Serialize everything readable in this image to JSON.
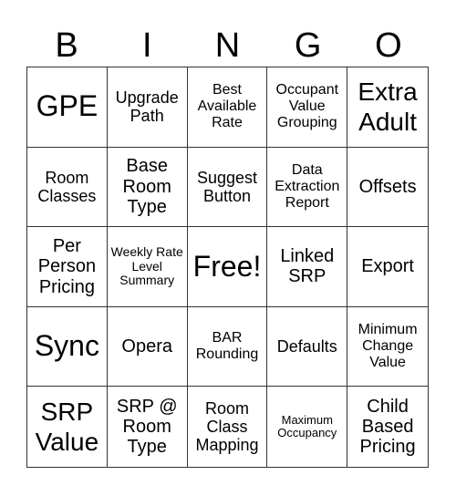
{
  "header": [
    "B",
    "I",
    "N",
    "G",
    "O"
  ],
  "cells": [
    {
      "text": "GPE",
      "size": "s-xl"
    },
    {
      "text": "Upgrade Path",
      "size": "s-n"
    },
    {
      "text": "Best Available Rate",
      "size": "s-s"
    },
    {
      "text": "Occupant Value Grouping",
      "size": "s-s"
    },
    {
      "text": "Extra Adult",
      "size": "s-l"
    },
    {
      "text": "Room Classes",
      "size": "s-n"
    },
    {
      "text": "Base Room Type",
      "size": "s-m"
    },
    {
      "text": "Suggest Button",
      "size": "s-n"
    },
    {
      "text": "Data Extraction Report",
      "size": "s-s"
    },
    {
      "text": "Offsets",
      "size": "s-m"
    },
    {
      "text": "Per Person Pricing",
      "size": "s-m"
    },
    {
      "text": "Weekly Rate Level Summary",
      "size": "s-xs"
    },
    {
      "text": "Free!",
      "size": "s-xl"
    },
    {
      "text": "Linked SRP",
      "size": "s-m"
    },
    {
      "text": "Export",
      "size": "s-m"
    },
    {
      "text": "Sync",
      "size": "s-xl"
    },
    {
      "text": "Opera",
      "size": "s-m"
    },
    {
      "text": "BAR Rounding",
      "size": "s-s"
    },
    {
      "text": "Defaults",
      "size": "s-n"
    },
    {
      "text": "Minimum Change Value",
      "size": "s-s"
    },
    {
      "text": "SRP Value",
      "size": "s-l"
    },
    {
      "text": "SRP @ Room Type",
      "size": "s-m"
    },
    {
      "text": "Room Class Mapping",
      "size": "s-n"
    },
    {
      "text": "Maximum Occupancy",
      "size": "s-xxs"
    },
    {
      "text": "Child Based Pricing",
      "size": "s-m"
    }
  ]
}
